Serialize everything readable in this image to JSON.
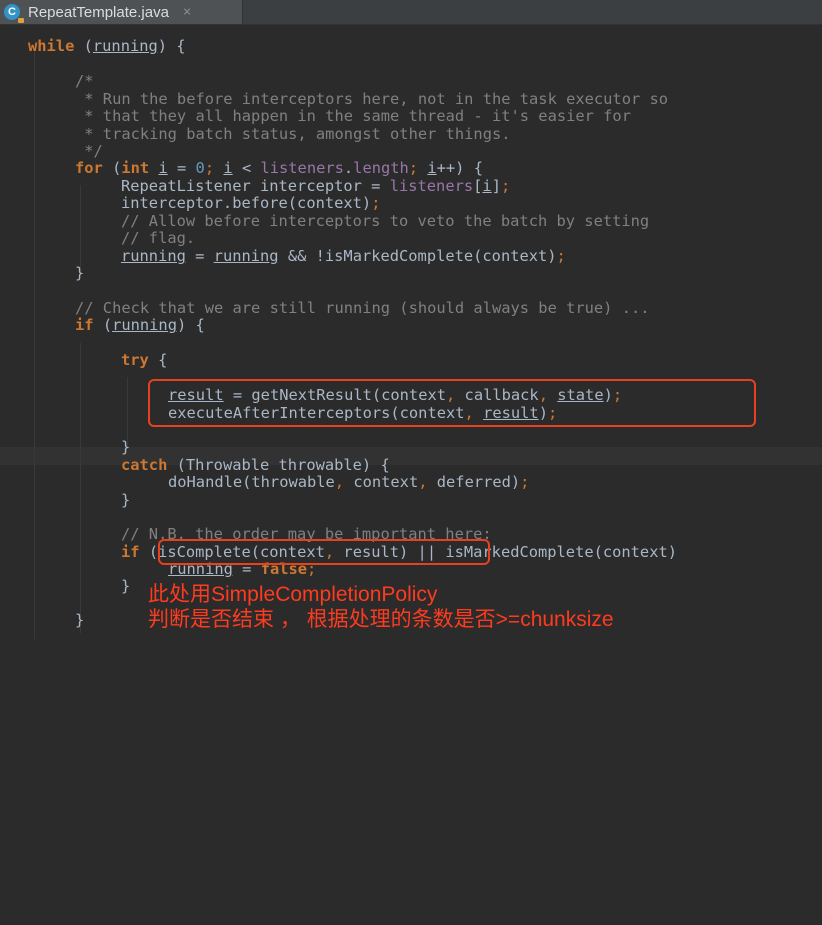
{
  "tab": {
    "title": "RepeatTemplate.java",
    "icon": "java-class-icon",
    "icon_letter": "C",
    "close": "×"
  },
  "colors": {
    "background": "#2b2b2b",
    "keyword": "#cc7832",
    "comment": "#808080",
    "number": "#6897bb",
    "field": "#9876aa",
    "text": "#a9b7c6",
    "annotation": "#ff3b1f"
  },
  "code": {
    "l01": {
      "kw": "while",
      "a": " (",
      "v": "running",
      "b": ") {"
    },
    "l03": "/*",
    "l04": " * Run the before interceptors here, not in the task executor so",
    "l05": " * that they all happen in the same thread - it's easier for",
    "l06": " * tracking batch status, amongst other things.",
    "l07": " */",
    "l08": {
      "kw1": "for",
      "a": " (",
      "kw2": "int",
      "b": " ",
      "v1": "i",
      "c": " = ",
      "num": "0",
      "s1": ";",
      "d": " ",
      "v2": "i",
      "e": " < ",
      "f1": "listeners",
      "g": ".",
      "f2": "length",
      "s2": ";",
      "h": " ",
      "v3": "i",
      "i2": "++) {"
    },
    "l09": {
      "a": "RepeatListener interceptor = ",
      "f": "listeners",
      "b": "[",
      "v": "i",
      "c": "]",
      "s": ";"
    },
    "l10": {
      "a": "interceptor.before(context)",
      "s": ";"
    },
    "l11": "// Allow before interceptors to veto the batch by setting",
    "l12": "// flag.",
    "l13": {
      "v1": "running",
      "a": " = ",
      "v2": "running",
      "b": " && !isMarkedComplete(context)",
      "s": ";"
    },
    "l14": "}",
    "l16": "// Check that we are still running (should always be true) ...",
    "l17": {
      "kw": "if",
      "a": " (",
      "v": "running",
      "b": ") {"
    },
    "l19": {
      "kw": "try",
      "a": " {"
    },
    "l21": {
      "v1": "result",
      "a": " = getNextResult(context",
      "c1": ",",
      "b": " callback",
      "c2": ",",
      "d": " ",
      "v2": "state",
      "e": ")",
      "s": ";"
    },
    "l22": {
      "a": "executeAfterInterceptors(context",
      "c": ",",
      "b": " ",
      "v": "result",
      "d": ")",
      "s": ";"
    },
    "l24": "}",
    "l25": {
      "kw": "catch",
      "a": " (Throwable throwable) {"
    },
    "l26": {
      "a": "doHandle(throwable",
      "c1": ",",
      "b": " context",
      "c2": ",",
      "d": " deferred)",
      "s": ";"
    },
    "l27": "}",
    "l29": "// N.B. the order may be important here:",
    "l30": {
      "kw": "if",
      "a": " (isComplete(context",
      "c1": ",",
      "b": " result) || isMarkedComplete(context)"
    },
    "l31": {
      "v": "running",
      "a": " = ",
      "kw": "false",
      "s": ";"
    },
    "l32": "}",
    "l34": "}"
  },
  "annotation": {
    "line1": "此处用SimpleCompletionPolicy",
    "line2": "判断是否结束 ， 根据处理的条数是否>=chunksize"
  }
}
